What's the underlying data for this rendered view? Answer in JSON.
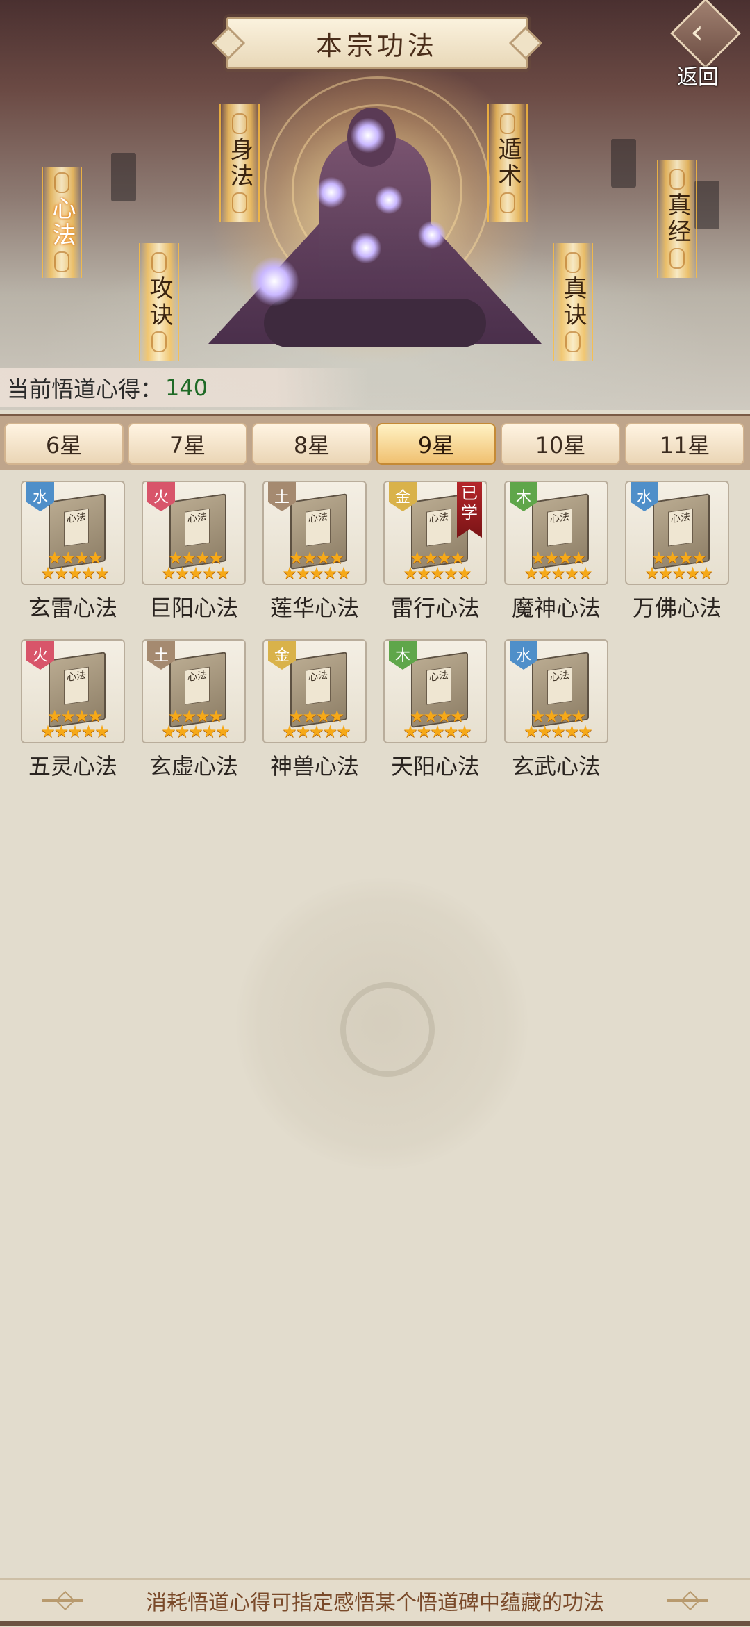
{
  "header": {
    "title": "本宗功法",
    "back_label": "返回",
    "back_icon": "return-arrow-icon"
  },
  "scene": {
    "talismans": [
      {
        "label": "心法",
        "active": true
      },
      {
        "label": "攻诀",
        "active": false
      },
      {
        "label": "身法",
        "active": false
      },
      {
        "label": "遁术",
        "active": false
      },
      {
        "label": "真诀",
        "active": false
      },
      {
        "label": "真经",
        "active": false
      }
    ]
  },
  "insight": {
    "label": "当前悟道心得：",
    "value": "140"
  },
  "tabs": [
    {
      "label": "6星"
    },
    {
      "label": "7星"
    },
    {
      "label": "8星"
    },
    {
      "label": "9星",
      "active": true
    },
    {
      "label": "10星"
    },
    {
      "label": "11星"
    }
  ],
  "element_colors": {
    "水": "#4f8fc9",
    "火": "#d8556a",
    "土": "#a58a70",
    "金": "#d9b24a",
    "木": "#5fa64a"
  },
  "star_color": "#f6a918",
  "items": [
    {
      "name": "玄雷心法",
      "element": "水",
      "stars": 9,
      "book_text": "心法"
    },
    {
      "name": "巨阳心法",
      "element": "火",
      "stars": 9,
      "book_text": "心法"
    },
    {
      "name": "莲华心法",
      "element": "土",
      "stars": 9,
      "book_text": "心法"
    },
    {
      "name": "雷行心法",
      "element": "金",
      "stars": 9,
      "book_text": "心法",
      "learned": "已学"
    },
    {
      "name": "魔神心法",
      "element": "木",
      "stars": 9,
      "book_text": "心法"
    },
    {
      "name": "万佛心法",
      "element": "水",
      "stars": 9,
      "book_text": "心法"
    },
    {
      "name": "五灵心法",
      "element": "火",
      "stars": 9,
      "book_text": "心法"
    },
    {
      "name": "玄虚心法",
      "element": "土",
      "stars": 9,
      "book_text": "心法"
    },
    {
      "name": "神兽心法",
      "element": "金",
      "stars": 9,
      "book_text": "心法"
    },
    {
      "name": "天阳心法",
      "element": "木",
      "stars": 9,
      "book_text": "心法"
    },
    {
      "name": "玄武心法",
      "element": "水",
      "stars": 9,
      "book_text": "心法"
    }
  ],
  "footer": {
    "text": "消耗悟道心得可指定感悟某个悟道碑中蕴藏的功法"
  }
}
